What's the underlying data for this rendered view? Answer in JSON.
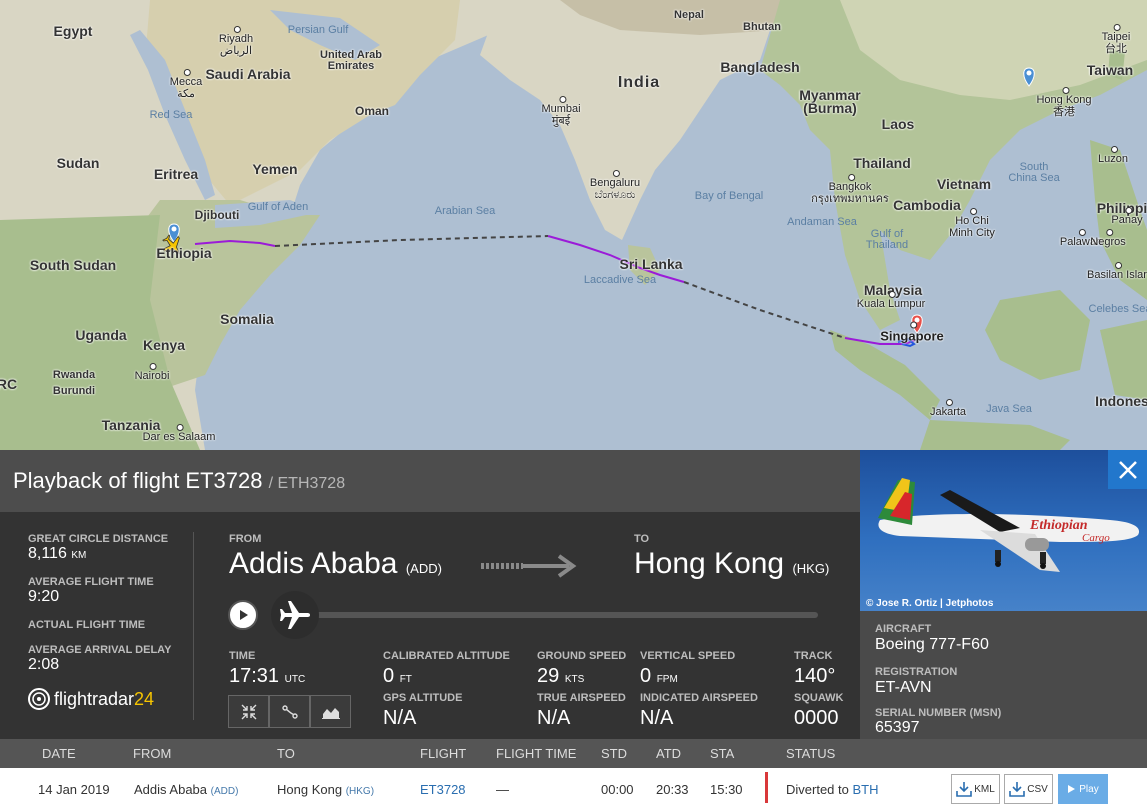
{
  "map": {
    "countries": [
      {
        "id": "egypt",
        "name": "Egypt"
      },
      {
        "id": "saudi",
        "name": "Saudi Arabia"
      },
      {
        "id": "sudan",
        "name": "Sudan"
      },
      {
        "id": "eritrea",
        "name": "Eritrea"
      },
      {
        "id": "yemen",
        "name": "Yemen"
      },
      {
        "id": "oman",
        "name": "Oman"
      },
      {
        "id": "uae",
        "name": "United Arab\nEmirates"
      },
      {
        "id": "djibouti",
        "name": "Djibouti"
      },
      {
        "id": "ethiopia",
        "name": "Ethiopia"
      },
      {
        "id": "south-sudan",
        "name": "South Sudan"
      },
      {
        "id": "somalia",
        "name": "Somalia"
      },
      {
        "id": "uganda",
        "name": "Uganda"
      },
      {
        "id": "kenya",
        "name": "Kenya"
      },
      {
        "id": "rwanda",
        "name": "Rwanda"
      },
      {
        "id": "burundi",
        "name": "Burundi"
      },
      {
        "id": "tanzania",
        "name": "Tanzania"
      },
      {
        "id": "drc",
        "name": "RC"
      },
      {
        "id": "india",
        "name": "India"
      },
      {
        "id": "nepal",
        "name": "Nepal"
      },
      {
        "id": "bhutan",
        "name": "Bhutan"
      },
      {
        "id": "bangladesh",
        "name": "Bangladesh"
      },
      {
        "id": "myanmar",
        "name": "Myanmar\n(Burma)"
      },
      {
        "id": "laos",
        "name": "Laos"
      },
      {
        "id": "thailand",
        "name": "Thailand"
      },
      {
        "id": "vietnam",
        "name": "Vietnam"
      },
      {
        "id": "cambodia",
        "name": "Cambodia"
      },
      {
        "id": "malaysia",
        "name": "Malaysia"
      },
      {
        "id": "sri-lanka",
        "name": "Sri Lanka"
      },
      {
        "id": "taiwan",
        "name": "Taiwan"
      },
      {
        "id": "philippines",
        "name": "Philippi"
      },
      {
        "id": "indonesia",
        "name": "Indones"
      }
    ],
    "seas": [
      {
        "id": "persian-gulf",
        "name": "Persian Gulf"
      },
      {
        "id": "red-sea",
        "name": "Red Sea"
      },
      {
        "id": "gulf-aden",
        "name": "Gulf of Aden"
      },
      {
        "id": "arabian-sea",
        "name": "Arabian Sea"
      },
      {
        "id": "bay-bengal",
        "name": "Bay of Bengal"
      },
      {
        "id": "laccadive",
        "name": "Laccadive Sea"
      },
      {
        "id": "andaman",
        "name": "Andaman Sea"
      },
      {
        "id": "gulf-thailand",
        "name": "Gulf of\nThailand"
      },
      {
        "id": "scs",
        "name": "South\nChina Sea"
      },
      {
        "id": "java-sea",
        "name": "Java Sea"
      },
      {
        "id": "celebes",
        "name": "Celebes Sea"
      }
    ],
    "cities": [
      {
        "id": "riyadh",
        "name": "Riyadh\nالرياض"
      },
      {
        "id": "mecca",
        "name": "Mecca\nمكة"
      },
      {
        "id": "mumbai",
        "name": "Mumbai\nमुंबई"
      },
      {
        "id": "bengaluru",
        "name": "Bengaluru\nಬೆಂಗಳೂರು"
      },
      {
        "id": "bangkok",
        "name": "Bangkok\nกรุงเทพมหานคร"
      },
      {
        "id": "hcmc",
        "name": "Ho Chi\nMinh City"
      },
      {
        "id": "kl",
        "name": "Kuala Lumpur"
      },
      {
        "id": "singapore",
        "name": "Singapore"
      },
      {
        "id": "jakarta",
        "name": "Jakarta"
      },
      {
        "id": "nairobi",
        "name": "Nairobi"
      },
      {
        "id": "dar",
        "name": "Dar es Salaam"
      },
      {
        "id": "taipei",
        "name": "Taipei\n台北"
      },
      {
        "id": "hong-kong",
        "name": "Hong Kong\n香港"
      },
      {
        "id": "luzon",
        "name": "Luzon"
      },
      {
        "id": "palawan",
        "name": "Palawan"
      },
      {
        "id": "negros",
        "name": "Negros"
      },
      {
        "id": "panay",
        "name": "Panay"
      },
      {
        "id": "basilan",
        "name": "Basilan Islar"
      }
    ]
  },
  "panel": {
    "title": "Playback of flight ET3728",
    "subtitle": "/ ETH3728",
    "great_circle_label": "GREAT CIRCLE DISTANCE",
    "great_circle_value": "8,116",
    "great_circle_unit": "KM",
    "avg_time_label": "AVERAGE FLIGHT TIME",
    "avg_time_value": "9:20",
    "actual_time_label": "ACTUAL FLIGHT TIME",
    "avg_delay_label": "AVERAGE ARRIVAL DELAY",
    "avg_delay_value": "2:08",
    "logo_text": "flightradar",
    "logo_num": "24",
    "from_label": "FROM",
    "from_city": "Addis Ababa",
    "from_iata": "(ADD)",
    "to_label": "TO",
    "to_city": "Hong Kong",
    "to_iata": "(HKG)",
    "time_label": "TIME",
    "time_value": "17:31",
    "time_unit": "UTC",
    "cal_alt_label": "CALIBRATED ALTITUDE",
    "cal_alt_value": "0",
    "cal_alt_unit": "FT",
    "gps_alt_label": "GPS ALTITUDE",
    "gps_alt_value": "N/A",
    "ground_speed_label": "GROUND SPEED",
    "ground_speed_value": "29",
    "ground_speed_unit": "KTS",
    "true_airspeed_label": "TRUE AIRSPEED",
    "true_airspeed_value": "N/A",
    "vert_speed_label": "VERTICAL SPEED",
    "vert_speed_value": "0",
    "vert_speed_unit": "FPM",
    "ind_airspeed_label": "INDICATED AIRSPEED",
    "ind_airspeed_value": "N/A",
    "track_label": "TRACK",
    "track_value": "140°",
    "squawk_label": "SQUAWK",
    "squawk_value": "0000"
  },
  "aircraft": {
    "photo_credit": "© Jose R. Ortiz | Jetphotos",
    "livery_text": "Ethiopian",
    "livery_sub": "Cargo",
    "aircraft_label": "AIRCRAFT",
    "aircraft_value": "Boeing 777-F60",
    "registration_label": "REGISTRATION",
    "registration_value": "ET-AVN",
    "serial_label": "SERIAL NUMBER (MSN)",
    "serial_value": "65397"
  },
  "table": {
    "headers": [
      "DATE",
      "FROM",
      "TO",
      "FLIGHT",
      "FLIGHT TIME",
      "STD",
      "ATD",
      "STA",
      "STATUS"
    ],
    "row": {
      "date": "14 Jan 2019",
      "from_city": "Addis Ababa",
      "from_iata": "(ADD)",
      "to_city": "Hong Kong",
      "to_iata": "(HKG)",
      "flight": "ET3728",
      "flight_time": "—",
      "std": "00:00",
      "atd": "20:33",
      "sta": "15:30",
      "status_text": "Diverted to",
      "status_link": "BTH",
      "kml_label": "KML",
      "csv_label": "CSV",
      "play_label": "Play"
    }
  },
  "colors": {
    "track_flown": "#9b1bd8",
    "track_estimated": "#444444",
    "accent": "#2277cc",
    "status_bar": "#d9383a"
  }
}
